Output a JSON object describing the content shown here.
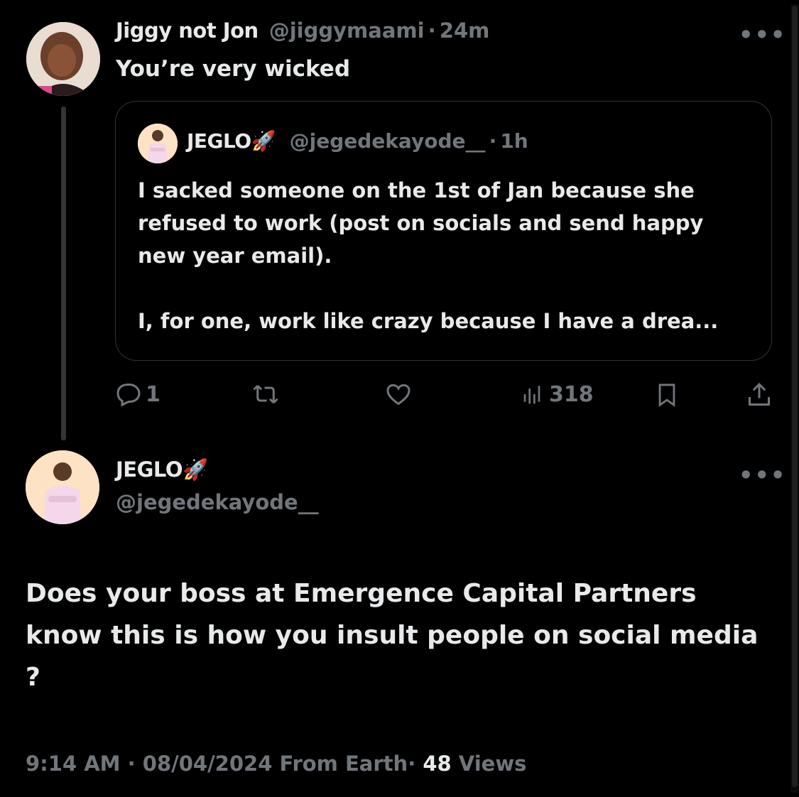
{
  "reply_parent": {
    "avatar_icon": "user-avatar-photo",
    "display_name": "Jiggy not Jon",
    "handle": "@jiggymaami",
    "separator": "·",
    "time": "24m",
    "text": "You’re very wicked",
    "more_label": "•••"
  },
  "quoted_tweet": {
    "avatar_icon": "user-avatar-photo",
    "display_name": "JEGLO",
    "emoji": "🚀",
    "handle": "@jegedekayode__",
    "separator": "·",
    "time": "1h",
    "line1": "I sacked someone on the 1st of Jan because she",
    "line2": "refused to work (post on socials and send happy",
    "line3": "new year email).",
    "line4": "I, for one, work like crazy because I have a drea..."
  },
  "actions": {
    "reply_count": "1",
    "retweet_count": "",
    "like_count": "",
    "views_count": "318"
  },
  "main_tweet": {
    "avatar_icon": "user-avatar-photo",
    "display_name": "JEGLO",
    "emoji": "🚀",
    "handle": "@jegedekayode__",
    "more_label": "•••",
    "text": "Does your boss at Emergence Capital Partners know this is how you insult people on social media ?",
    "time": "9:14 AM",
    "separator": "·",
    "date": "08/04/2024",
    "source": "From Earth",
    "views_count": "48",
    "views_label": "Views"
  },
  "colors": {
    "background": "#000000",
    "text_primary": "#e7e9ea",
    "text_muted": "#71767b",
    "border": "#2f3336"
  }
}
